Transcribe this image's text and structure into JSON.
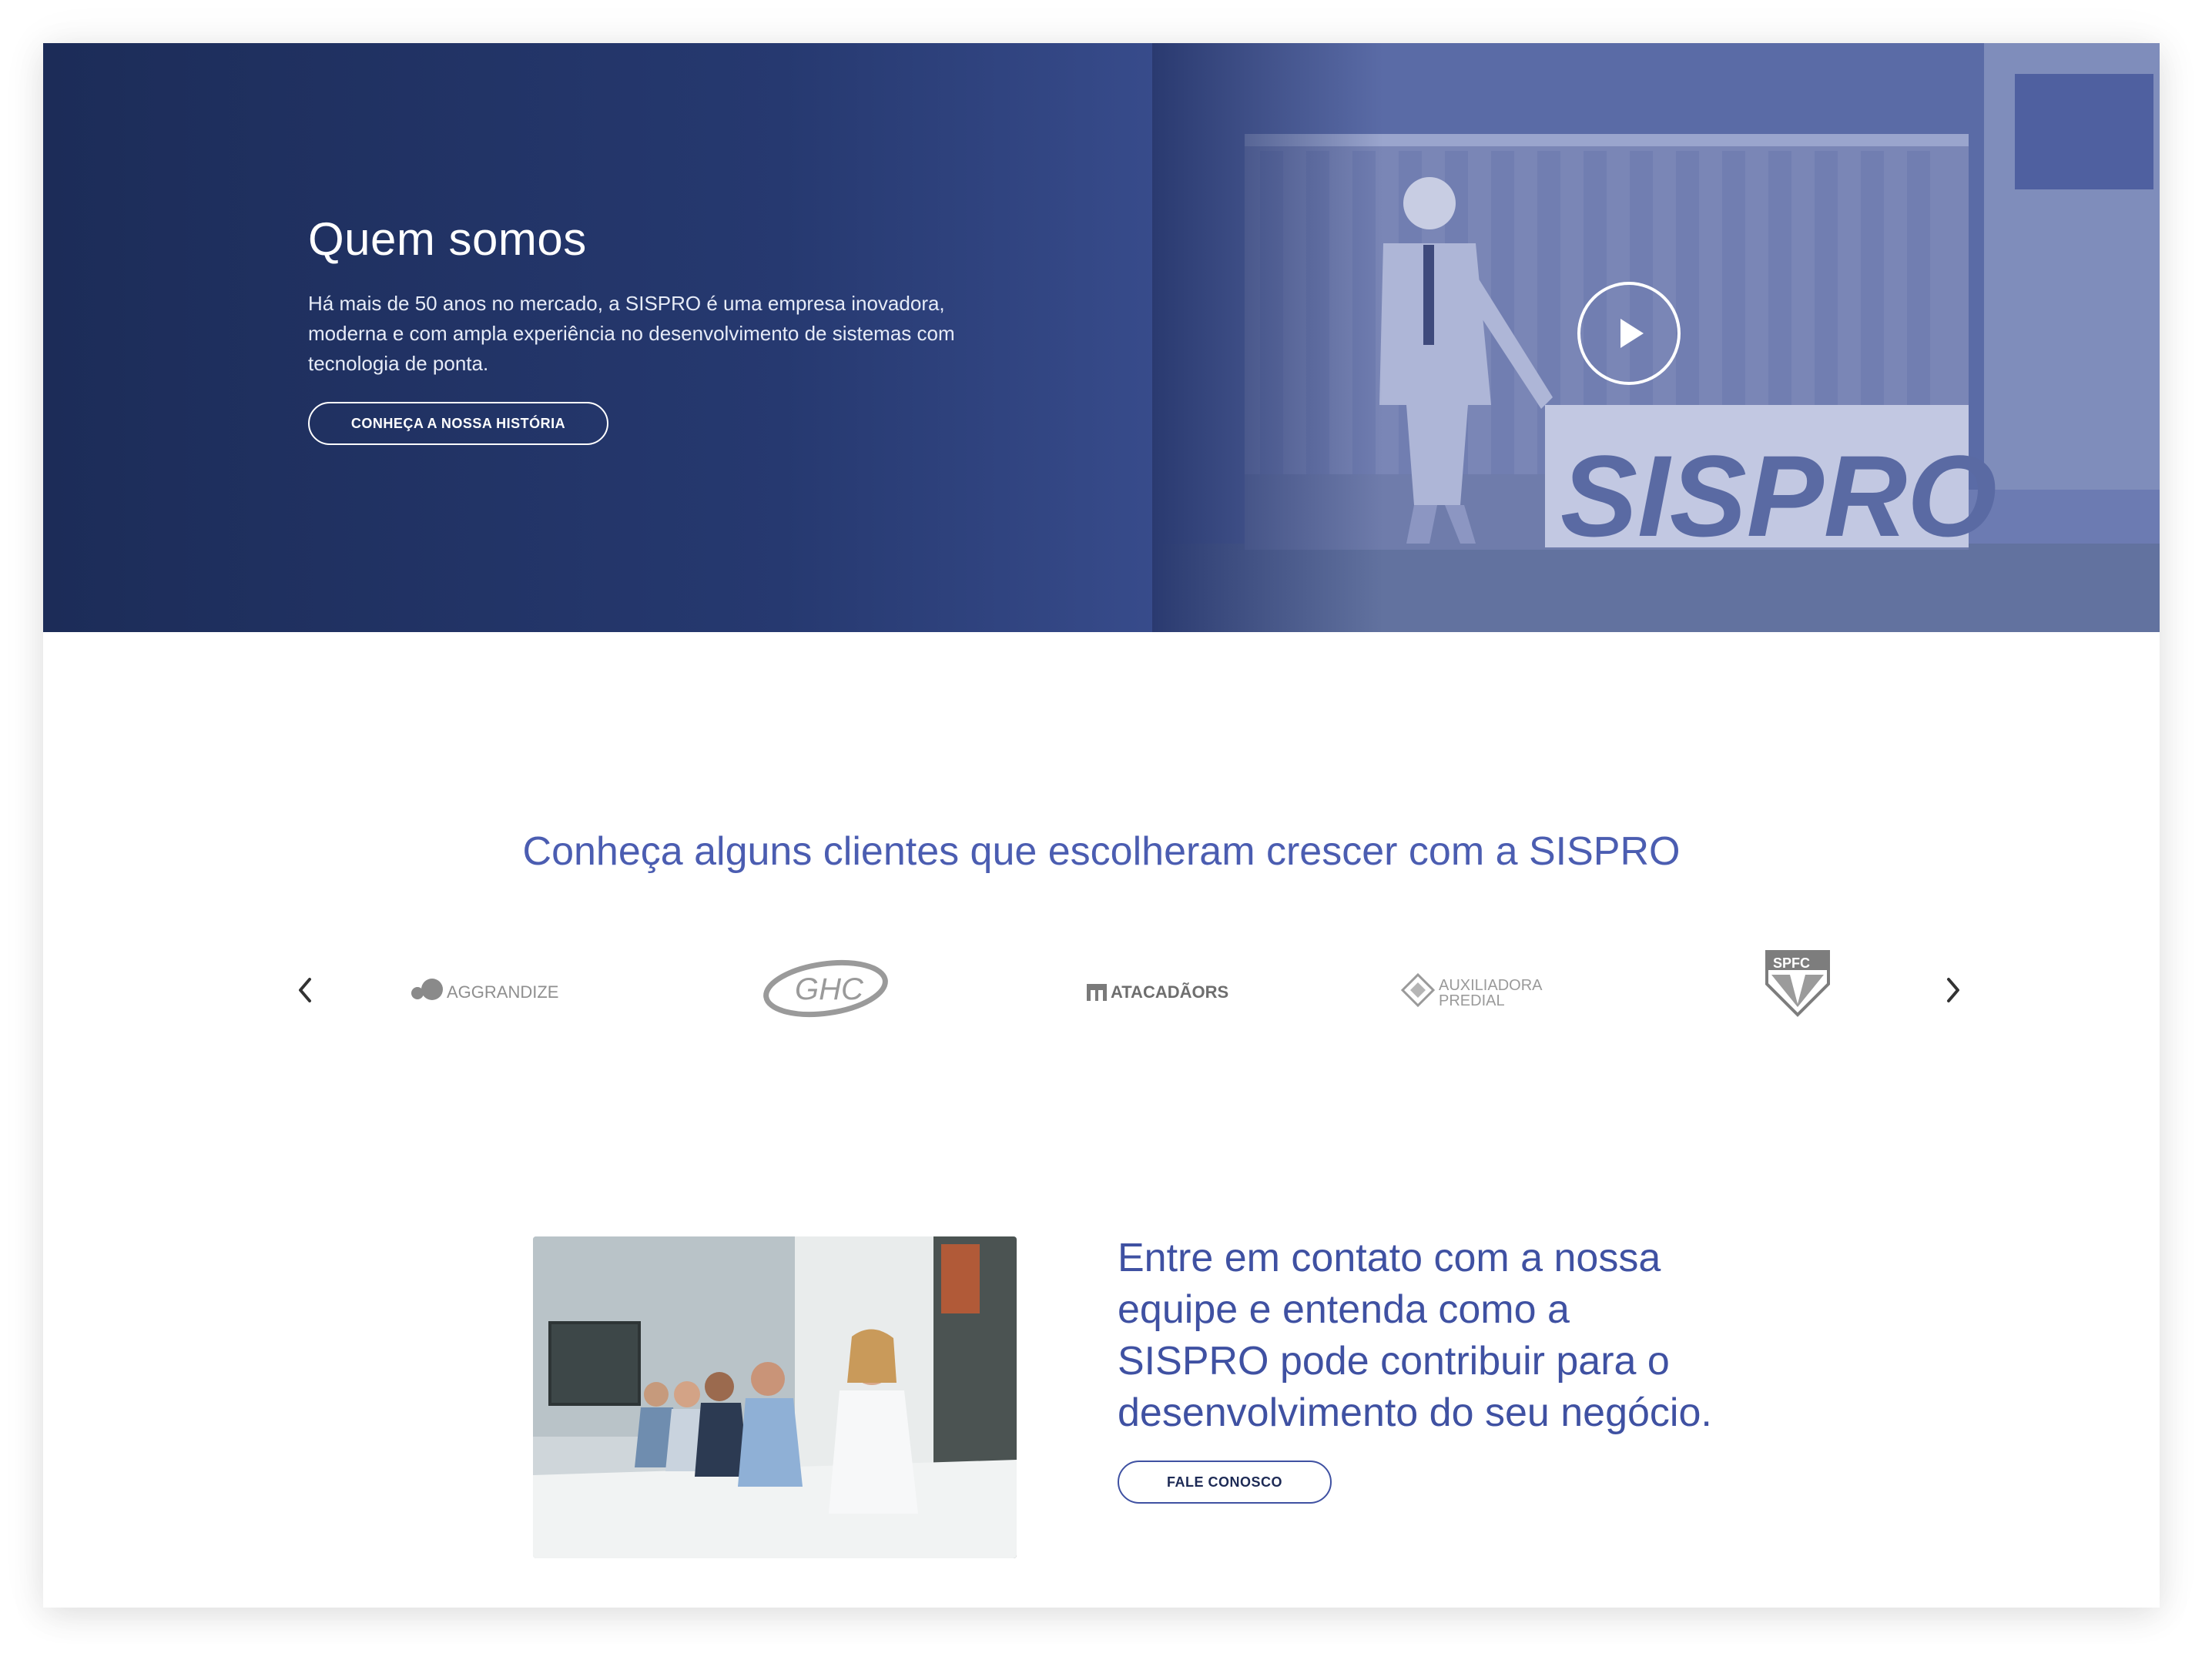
{
  "hero": {
    "title": "Quem somos",
    "description": "Há mais de 50 anos no mercado, a SISPRO é uma empresa inovadora, moderna e com ampla experiência no desenvolvimento de sistemas com tecnologia de ponta.",
    "button_label": "CONHEÇA A NOSSA HISTÓRIA",
    "photo_sign_text": "SISPRO",
    "colors": {
      "dark_navy": "#1c2c58",
      "overlay_blue": "#56679f"
    }
  },
  "clients": {
    "heading": "Conheça alguns clientes que escolheram crescer com a SISPRO",
    "prev_icon": "chevron-left-icon",
    "next_icon": "chevron-right-icon",
    "logos": [
      {
        "name": "AGGRANDIZE"
      },
      {
        "name": "GHC"
      },
      {
        "name": "ATACADÃORS"
      },
      {
        "name": "AUXILIADORA",
        "sub": "PREDIAL"
      },
      {
        "name": "SPFC"
      }
    ]
  },
  "contact": {
    "heading": "Entre em contato com a nossa equipe e entenda como a SISPRO pode contribuir para o desenvolvimento do seu negócio.",
    "button_label": "FALE CONOSCO",
    "accent_color": "#3f51a2"
  }
}
